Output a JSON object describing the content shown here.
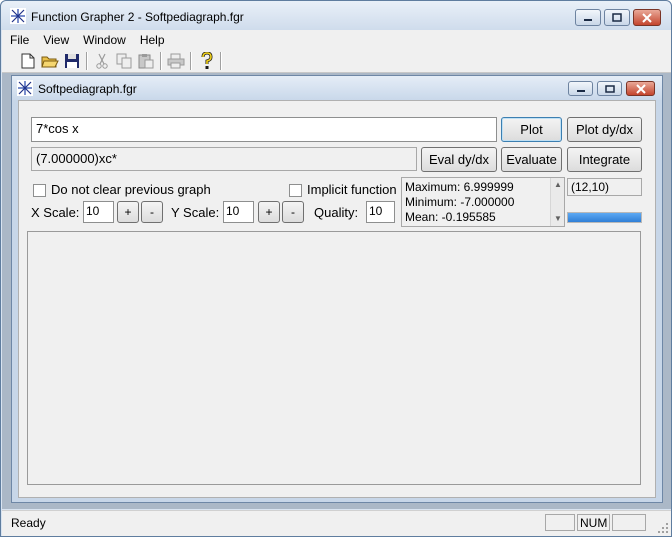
{
  "window": {
    "title": "Function Grapher 2 - Softpediagraph.fgr"
  },
  "menu": [
    "File",
    "View",
    "Window",
    "Help"
  ],
  "toolbar": {
    "icons": [
      "new-icon",
      "open-icon",
      "save-icon",
      "cut-icon",
      "copy-icon",
      "paste-icon",
      "print-icon",
      "help-icon"
    ]
  },
  "child": {
    "title": "Softpediagraph.fgr"
  },
  "form": {
    "function_value": "7*cos x",
    "result_value": "(7.000000)xc*",
    "plot_label": "Plot",
    "plot_dydx_label": "Plot dy/dx",
    "eval_dydx_label": "Eval dy/dx",
    "evaluate_label": "Evaluate",
    "integrate_label": "Integrate",
    "no_clear_label": "Do not clear previous graph",
    "implicit_label": "Implicit function",
    "xscale_label": "X Scale:",
    "xscale_value": "10",
    "yscale_label": "Y Scale:",
    "yscale_value": "10",
    "quality_label": "Quality:",
    "quality_value": "10",
    "plus": "+",
    "minus": "-"
  },
  "stats": {
    "maximum": "Maximum: 6.999999",
    "minimum": "Minimum: -7.000000",
    "mean": "Mean: -0.195585"
  },
  "coord": "(12,10)",
  "progress_fraction": 1.0,
  "status": {
    "text": "Ready",
    "num": "NUM"
  }
}
